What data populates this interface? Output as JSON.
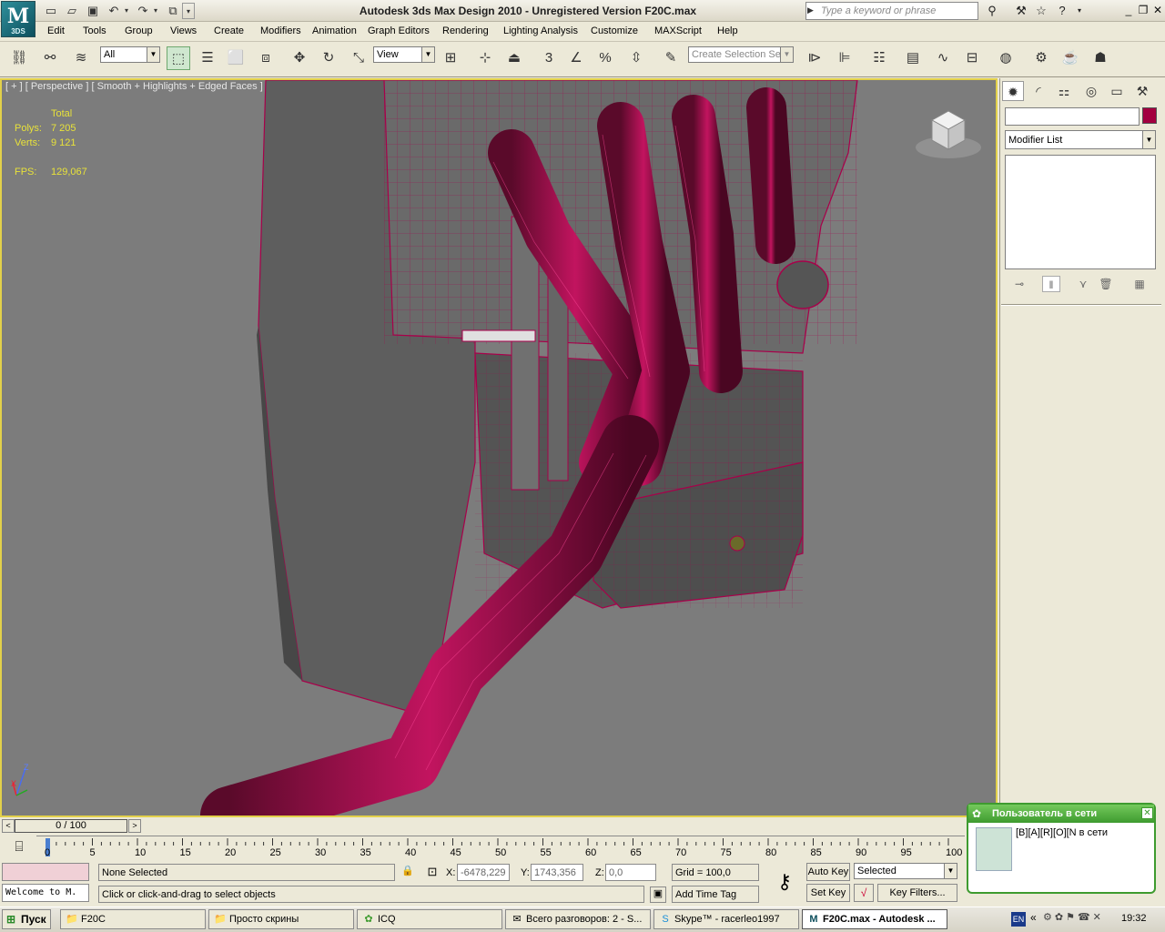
{
  "app": {
    "title": "Autodesk 3ds Max Design 2010  - Unregistered Version     F20C.max",
    "logo": "M",
    "logo_sub": "3DS",
    "search_placeholder": "Type a keyword or phrase"
  },
  "menu": [
    "Edit",
    "Tools",
    "Group",
    "Views",
    "Create",
    "Modifiers",
    "Animation",
    "Graph Editors",
    "Rendering",
    "Lighting Analysis",
    "Customize",
    "MAXScript",
    "Help"
  ],
  "toolbar": {
    "filter_value": "All",
    "refcoord_value": "View",
    "selection_set_placeholder": "Create Selection Se",
    "snap_3": "3",
    "percent": "%"
  },
  "viewport": {
    "label": "[ + ] [ Perspective ] [ Smooth + Highlights + Edged Faces ]",
    "stats": {
      "total_label": "Total",
      "polys_label": "Polys:",
      "polys": "7 205",
      "verts_label": "Verts:",
      "verts": "9 121",
      "fps_label": "FPS:",
      "fps": "129,067"
    },
    "axis_z": "Z",
    "axis_x": "X",
    "wire_color": "#a8004a",
    "accent_border": "#e2d04a"
  },
  "command_panel": {
    "modifier_list": "Modifier List",
    "object_color": "#a3003f"
  },
  "timeline": {
    "position": "0 / 100",
    "ticks": [
      "0",
      "5",
      "10",
      "15",
      "20",
      "25",
      "30",
      "35",
      "40",
      "45",
      "50",
      "55",
      "60",
      "65",
      "70",
      "75",
      "80",
      "85",
      "90",
      "95",
      "100"
    ]
  },
  "status": {
    "script_listener": "Welcome to M.",
    "selection": "None Selected",
    "prompt": "Click or click-and-drag to select objects",
    "x_label": "X:",
    "x": "-6478,229",
    "y_label": "Y:",
    "y": "1743,356",
    "z_label": "Z:",
    "z": "0,0",
    "grid": "Grid = 100,0",
    "add_time_tag": "Add Time Tag",
    "auto_key": "Auto Key",
    "set_key": "Set Key",
    "selected": "Selected",
    "key_filters": "Key Filters..."
  },
  "icq_popup": {
    "title": "Пользователь в сети",
    "message": "[B][A][R][O][N в сети"
  },
  "taskbar": {
    "start": "Пуск",
    "tasks": [
      {
        "label": "F20C",
        "icon": "folder"
      },
      {
        "label": "Просто скрины",
        "icon": "folder"
      },
      {
        "label": "ICQ",
        "icon": "icq"
      },
      {
        "label": "Всего разговоров: 2 - S...",
        "icon": "chat"
      },
      {
        "label": "Skype™ - racerleo1997",
        "icon": "skype"
      },
      {
        "label": "F20C.max - Autodesk ...",
        "icon": "max"
      }
    ],
    "lang": "EN",
    "clock": "19:32"
  }
}
